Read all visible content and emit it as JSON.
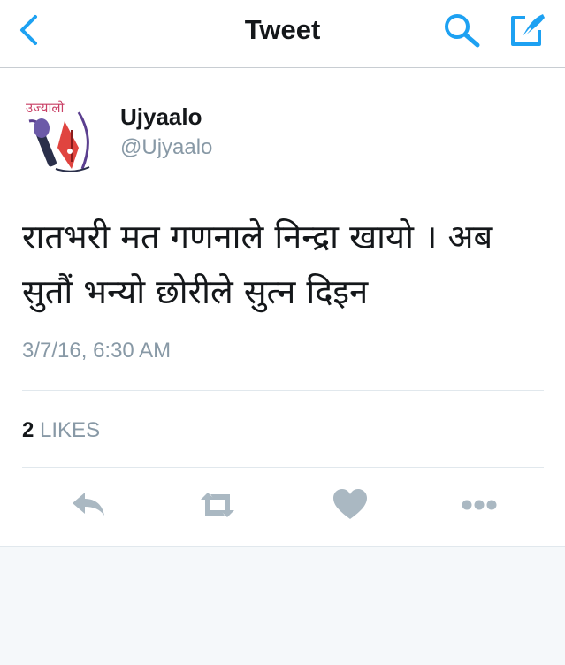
{
  "nav": {
    "back_icon": "chevron-left-icon",
    "title": "Tweet",
    "search_icon": "search-icon",
    "compose_icon": "compose-icon",
    "accent_color": "#1da1f2"
  },
  "tweet": {
    "avatar_icon": "ujyaalo-logo",
    "avatar_text": "उज्यालो",
    "display_name": "Ujyaalo",
    "handle": "@Ujyaalo",
    "text": "रातभरी मत गणनाले निन्द्रा खायो । अब सुतौं भन्यो छोरीले सुत्न दिइन",
    "timestamp": "3/7/16, 6:30 AM",
    "likes_count": "2",
    "likes_label": "LIKES"
  },
  "actions": {
    "reply_icon": "reply-icon",
    "retweet_icon": "retweet-icon",
    "like_icon": "heart-icon",
    "more_icon": "more-icon",
    "icon_color": "#aab8c2"
  }
}
